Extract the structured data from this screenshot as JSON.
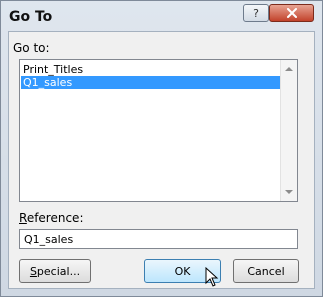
{
  "dialog": {
    "title": "Go To",
    "help_icon": "question-mark-icon",
    "close_icon": "close-x-icon"
  },
  "goto": {
    "label": "Go to:",
    "items": [
      {
        "label": "Print_Titles",
        "selected": false
      },
      {
        "label": "Q1_sales",
        "selected": true
      }
    ]
  },
  "reference": {
    "label": "Reference:",
    "value": "Q1_sales"
  },
  "buttons": {
    "special": "Special...",
    "ok": "OK",
    "cancel": "Cancel"
  },
  "colors": {
    "selection": "#3399ff",
    "close_button": "#c2422b"
  }
}
